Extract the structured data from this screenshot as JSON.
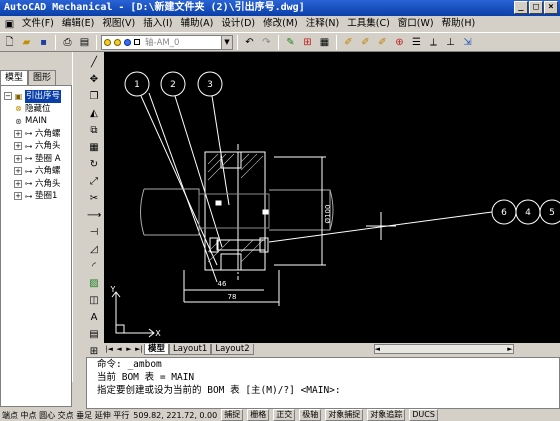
{
  "window": {
    "title": "AutoCAD Mechanical - [D:\\新建文件夹 (2)\\引出序号.dwg]",
    "buttons": [
      "_",
      "□",
      "×"
    ]
  },
  "menu": [
    "文件(F)",
    "编辑(E)",
    "视图(V)",
    "插入(I)",
    "辅助(A)",
    "设计(D)",
    "修改(M)",
    "注释(N)",
    "工具集(C)",
    "窗口(W)",
    "帮助(H)"
  ],
  "toolbar": {
    "layer_name": "轴-AM_0"
  },
  "browser": {
    "tabs": [
      "模型",
      "图形"
    ],
    "items": [
      {
        "label": "引出序号",
        "icon": "assembly-icon",
        "selected": true,
        "level": 0
      },
      {
        "label": "隐藏位",
        "icon": "hidden-icon",
        "level": 1
      },
      {
        "label": "MAIN",
        "icon": "main-icon",
        "level": 1
      },
      {
        "label": "六角螺",
        "icon": "bolt-icon",
        "level": 1
      },
      {
        "label": "六角头",
        "icon": "bolt-icon",
        "level": 1
      },
      {
        "label": "垫圈 A",
        "icon": "washer-icon",
        "level": 1
      },
      {
        "label": "六角螺",
        "icon": "bolt-icon",
        "level": 1
      },
      {
        "label": "六角头",
        "icon": "bolt-icon",
        "level": 1
      },
      {
        "label": "垫圈1",
        "icon": "washer-icon",
        "level": 1
      }
    ]
  },
  "drawing": {
    "balloons_left": [
      "1",
      "2",
      "3"
    ],
    "balloons_right": [
      "6",
      "4",
      "5"
    ],
    "dims": {
      "width_46": "46",
      "width_78": "78",
      "dia": "Ø100"
    },
    "ucs_x": "X",
    "ucs_y": "Y"
  },
  "layout_tabs": [
    "模型",
    "Layout1",
    "Layout2"
  ],
  "command_lines": [
    "命令: _ambom",
    "当前 BOM 表 = MAIN",
    "指定要创建或设为当前的 BOM 表 [主(M)/?]  <MAIN>:"
  ],
  "status": {
    "osnap_text": "端点 中点 圆心 交点 垂足 延伸 平行",
    "coords": "509.82, 221.72, 0.00",
    "buttons": [
      "捕捉",
      "栅格",
      "正交",
      "极轴",
      "对象捕捉",
      "对象追踪",
      "DUCS"
    ]
  }
}
